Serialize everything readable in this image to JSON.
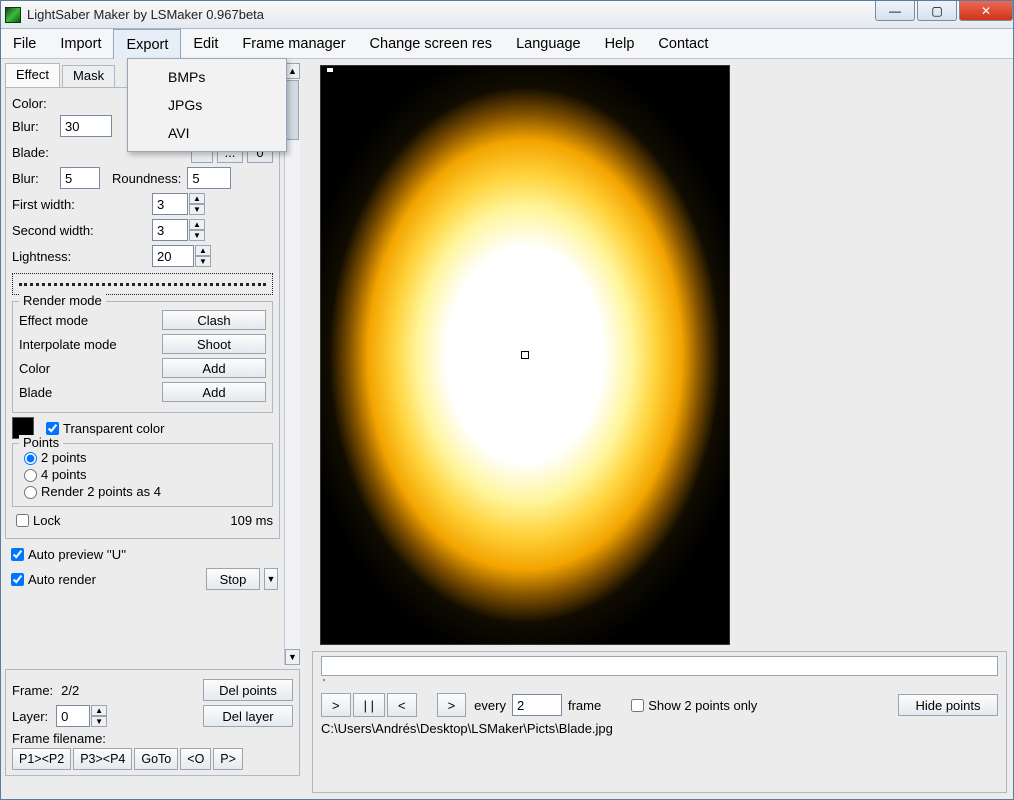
{
  "window": {
    "title": "LightSaber Maker by LSMaker 0.967beta"
  },
  "menu": {
    "items": [
      "File",
      "Import",
      "Export",
      "Edit",
      "Frame manager",
      "Change screen res",
      "Language",
      "Help",
      "Contact"
    ],
    "open_index": 2,
    "dropdown": [
      "BMPs",
      "JPGs",
      "AVI"
    ]
  },
  "tabs": {
    "effect": "Effect",
    "mask": "Mask"
  },
  "effect": {
    "color_label": "Color:",
    "blur1_label": "Blur:",
    "blur1": "30",
    "blade_label": "Blade:",
    "blade_btn_dots": "...",
    "blade_btn_zero": "0",
    "blur2_label": "Blur:",
    "blur2": "5",
    "roundness_label": "Roundness:",
    "roundness": "5",
    "first_width_label": "First width:",
    "first_width": "3",
    "second_width_label": "Second width:",
    "second_width": "3",
    "lightness_label": "Lightness:",
    "lightness": "20"
  },
  "render_mode": {
    "legend": "Render mode",
    "rows": [
      {
        "label": "Effect mode",
        "btn": "Clash"
      },
      {
        "label": "Interpolate mode",
        "btn": "Shoot"
      },
      {
        "label": "Color",
        "btn": "Add"
      },
      {
        "label": "Blade",
        "btn": "Add"
      }
    ]
  },
  "transparent": {
    "label": "Transparent color",
    "checked": true
  },
  "points": {
    "legend": "Points",
    "options": [
      "2 points",
      "4 points",
      "Render 2 points as 4"
    ],
    "selected": 0
  },
  "lock": {
    "label": "Lock",
    "time": "109 ms"
  },
  "auto_preview": {
    "label": "Auto preview ''U''",
    "checked": true
  },
  "auto_render": {
    "label": "Auto render",
    "checked": true,
    "stop": "Stop"
  },
  "frame_panel": {
    "frame_label": "Frame:",
    "frame_value": "2/2",
    "layer_label": "Layer:",
    "layer_value": "0",
    "del_points": "Del points",
    "del_layer": "Del layer",
    "frame_filename_label": "Frame filename:",
    "btns": [
      "P1><P2",
      "P3><P4",
      "GoTo",
      "<O",
      "P>"
    ]
  },
  "player": {
    "controls": [
      ">",
      "| |",
      "<",
      ">"
    ],
    "every_label": "every",
    "every_value": "2",
    "frame_label": "frame",
    "show2": "Show 2 points only",
    "hide": "Hide points",
    "path": "C:\\Users\\Andrés\\Desktop\\LSMaker\\Picts\\Blade.jpg"
  }
}
